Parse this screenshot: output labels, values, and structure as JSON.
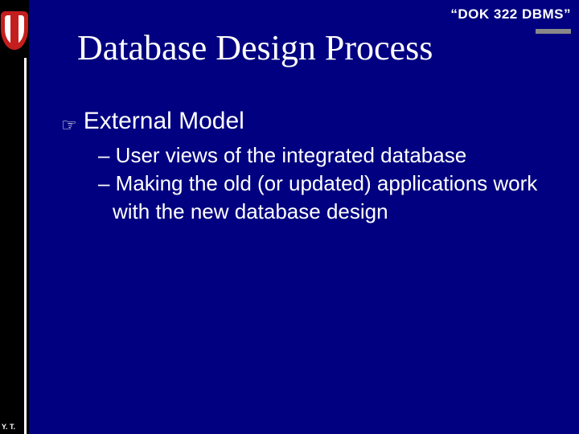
{
  "course_label": "“DOK 322 DBMS”",
  "title": "Database Design Process",
  "bullet": {
    "icon": "☞",
    "text": "External Model"
  },
  "sub_items": [
    "– User views of the integrated database",
    "– Making the old (or updated) applications work with the new database design"
  ],
  "footer": "Y. T."
}
